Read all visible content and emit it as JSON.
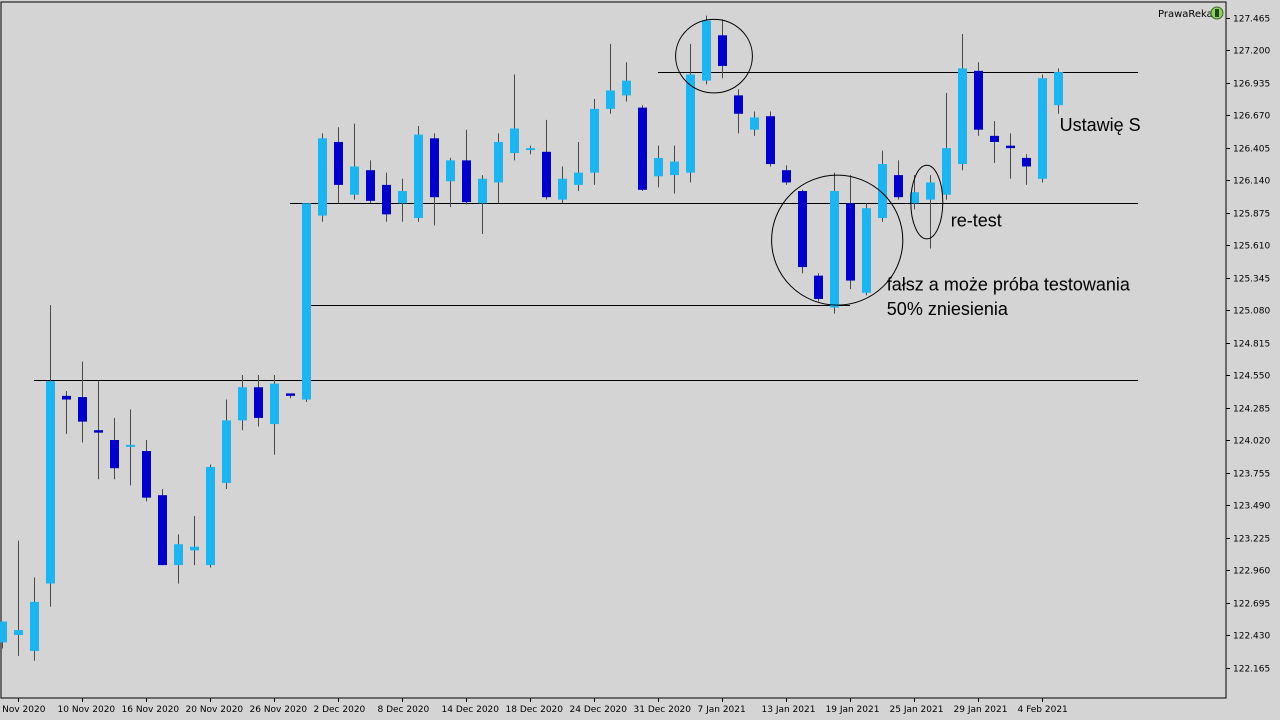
{
  "chart_data": {
    "type": "candlestick",
    "symbol_brand": "PrawaReka",
    "colors": {
      "background": "#d4d4d4",
      "bull": "#1eb4f0",
      "bear": "#0000c8",
      "wick": "#4a4a4a",
      "line": "#000000",
      "axis": "#000000"
    },
    "y_range": [
      122.0,
      127.5
    ],
    "y_ticks": [
      "127.465",
      "127.200",
      "126.935",
      "126.670",
      "126.405",
      "126.140",
      "125.875",
      "125.610",
      "125.345",
      "125.080",
      "124.815",
      "124.550",
      "124.285",
      "124.020",
      "123.755",
      "123.490",
      "123.225",
      "122.960",
      "122.695",
      "122.430",
      "122.165"
    ],
    "x_labels": [
      {
        "index": 1,
        "text": "4 Nov 2020"
      },
      {
        "index": 5,
        "text": "10 Nov 2020"
      },
      {
        "index": 9,
        "text": "16 Nov 2020"
      },
      {
        "index": 13,
        "text": "20 Nov 2020"
      },
      {
        "index": 17,
        "text": "26 Nov 2020"
      },
      {
        "index": 21,
        "text": "2 Dec 2020"
      },
      {
        "index": 25,
        "text": "8 Dec 2020"
      },
      {
        "index": 29,
        "text": "14 Dec 2020"
      },
      {
        "index": 33,
        "text": "18 Dec 2020"
      },
      {
        "index": 37,
        "text": "24 Dec 2020"
      },
      {
        "index": 41,
        "text": "31 Dec 2020"
      },
      {
        "index": 45,
        "text": "7 Jan 2021"
      },
      {
        "index": 49,
        "text": "13 Jan 2021"
      },
      {
        "index": 53,
        "text": "19 Jan 2021"
      },
      {
        "index": 57,
        "text": "25 Jan 2021"
      },
      {
        "index": 61,
        "text": "29 Jan 2021"
      },
      {
        "index": 65,
        "text": "4 Feb 2021"
      }
    ],
    "candles": [
      {
        "o": 122.37,
        "h": 122.5,
        "l": 122.32,
        "c": 122.54
      },
      {
        "o": 122.43,
        "h": 123.2,
        "l": 122.26,
        "c": 122.47
      },
      {
        "o": 122.3,
        "h": 122.9,
        "l": 122.22,
        "c": 122.7
      },
      {
        "o": 122.85,
        "h": 125.12,
        "l": 122.66,
        "c": 124.5
      },
      {
        "o": 124.38,
        "h": 124.42,
        "l": 124.07,
        "c": 124.35
      },
      {
        "o": 124.37,
        "h": 124.66,
        "l": 124.0,
        "c": 124.17
      },
      {
        "o": 124.1,
        "h": 124.5,
        "l": 123.7,
        "c": 124.08
      },
      {
        "o": 124.02,
        "h": 124.2,
        "l": 123.7,
        "c": 123.79
      },
      {
        "o": 123.98,
        "h": 124.27,
        "l": 123.65,
        "c": 123.98
      },
      {
        "o": 123.93,
        "h": 124.02,
        "l": 123.52,
        "c": 123.55
      },
      {
        "o": 123.57,
        "h": 123.62,
        "l": 123.02,
        "c": 123.0
      },
      {
        "o": 123.0,
        "h": 123.25,
        "l": 122.85,
        "c": 123.17
      },
      {
        "o": 123.12,
        "h": 123.4,
        "l": 123.0,
        "c": 123.15
      },
      {
        "o": 123.0,
        "h": 123.82,
        "l": 122.98,
        "c": 123.8
      },
      {
        "o": 123.67,
        "h": 124.35,
        "l": 123.62,
        "c": 124.18
      },
      {
        "o": 124.18,
        "h": 124.55,
        "l": 124.1,
        "c": 124.45
      },
      {
        "o": 124.45,
        "h": 124.55,
        "l": 124.13,
        "c": 124.2
      },
      {
        "o": 124.15,
        "h": 124.55,
        "l": 123.9,
        "c": 124.48
      },
      {
        "o": 124.4,
        "h": 124.4,
        "l": 124.36,
        "c": 124.38
      },
      {
        "o": 124.35,
        "h": 125.1,
        "l": 124.33,
        "c": 125.95
      },
      {
        "o": 125.85,
        "h": 126.52,
        "l": 125.8,
        "c": 126.48
      },
      {
        "o": 126.45,
        "h": 126.57,
        "l": 125.95,
        "c": 126.1
      },
      {
        "o": 126.02,
        "h": 126.6,
        "l": 125.98,
        "c": 126.25
      },
      {
        "o": 126.22,
        "h": 126.3,
        "l": 125.95,
        "c": 125.97
      },
      {
        "o": 126.1,
        "h": 126.2,
        "l": 125.8,
        "c": 125.86
      },
      {
        "o": 125.95,
        "h": 126.15,
        "l": 125.8,
        "c": 126.05
      },
      {
        "o": 125.83,
        "h": 126.58,
        "l": 125.8,
        "c": 126.51
      },
      {
        "o": 126.48,
        "h": 126.52,
        "l": 125.77,
        "c": 126.0
      },
      {
        "o": 126.13,
        "h": 126.32,
        "l": 125.92,
        "c": 126.3
      },
      {
        "o": 126.3,
        "h": 126.55,
        "l": 125.94,
        "c": 125.96
      },
      {
        "o": 125.95,
        "h": 126.18,
        "l": 125.7,
        "c": 126.15
      },
      {
        "o": 126.12,
        "h": 126.52,
        "l": 125.95,
        "c": 126.45
      },
      {
        "o": 126.36,
        "h": 127.0,
        "l": 126.3,
        "c": 126.56
      },
      {
        "o": 126.4,
        "h": 126.42,
        "l": 126.35,
        "c": 126.4
      },
      {
        "o": 126.37,
        "h": 126.63,
        "l": 125.98,
        "c": 126.0
      },
      {
        "o": 125.98,
        "h": 126.25,
        "l": 125.95,
        "c": 126.15
      },
      {
        "o": 126.1,
        "h": 126.45,
        "l": 126.05,
        "c": 126.2
      },
      {
        "o": 126.2,
        "h": 126.8,
        "l": 126.1,
        "c": 126.72
      },
      {
        "o": 126.72,
        "h": 127.25,
        "l": 126.68,
        "c": 126.87
      },
      {
        "o": 126.83,
        "h": 127.1,
        "l": 126.78,
        "c": 126.95
      },
      {
        "o": 126.73,
        "h": 126.75,
        "l": 126.05,
        "c": 126.06
      },
      {
        "o": 126.17,
        "h": 126.42,
        "l": 126.08,
        "c": 126.32
      },
      {
        "o": 126.18,
        "h": 126.42,
        "l": 126.03,
        "c": 126.29
      },
      {
        "o": 126.2,
        "h": 127.25,
        "l": 126.12,
        "c": 127.0
      },
      {
        "o": 126.95,
        "h": 127.48,
        "l": 126.92,
        "c": 127.44
      },
      {
        "o": 127.32,
        "h": 127.45,
        "l": 126.97,
        "c": 127.07
      },
      {
        "o": 126.83,
        "h": 126.88,
        "l": 126.52,
        "c": 126.68
      },
      {
        "o": 126.55,
        "h": 126.7,
        "l": 126.5,
        "c": 126.65
      },
      {
        "o": 126.66,
        "h": 126.7,
        "l": 126.25,
        "c": 126.27
      },
      {
        "o": 126.22,
        "h": 126.26,
        "l": 126.1,
        "c": 126.12
      },
      {
        "o": 126.05,
        "h": 126.06,
        "l": 125.38,
        "c": 125.43
      },
      {
        "o": 125.36,
        "h": 125.38,
        "l": 125.15,
        "c": 125.17
      },
      {
        "o": 125.1,
        "h": 126.2,
        "l": 125.05,
        "c": 126.05
      },
      {
        "o": 125.95,
        "h": 126.18,
        "l": 125.25,
        "c": 125.32
      },
      {
        "o": 125.22,
        "h": 125.95,
        "l": 125.2,
        "c": 125.91
      },
      {
        "o": 125.83,
        "h": 126.38,
        "l": 125.8,
        "c": 126.27
      },
      {
        "o": 126.18,
        "h": 126.3,
        "l": 125.98,
        "c": 126.0
      },
      {
        "o": 125.95,
        "h": 126.18,
        "l": 125.9,
        "c": 126.04
      },
      {
        "o": 125.98,
        "h": 126.18,
        "l": 125.58,
        "c": 126.12
      },
      {
        "o": 126.02,
        "h": 126.85,
        "l": 125.98,
        "c": 126.4
      },
      {
        "o": 126.27,
        "h": 127.33,
        "l": 126.22,
        "c": 127.05
      },
      {
        "o": 127.03,
        "h": 127.1,
        "l": 126.5,
        "c": 126.55
      },
      {
        "o": 126.5,
        "h": 126.62,
        "l": 126.28,
        "c": 126.45
      },
      {
        "o": 126.42,
        "h": 126.52,
        "l": 126.15,
        "c": 126.4
      },
      {
        "o": 126.32,
        "h": 126.35,
        "l": 126.1,
        "c": 126.25
      },
      {
        "o": 126.15,
        "h": 127.0,
        "l": 126.12,
        "c": 126.97
      },
      {
        "o": 126.75,
        "h": 127.05,
        "l": 126.68,
        "c": 127.02
      }
    ],
    "hlines": [
      {
        "price": 127.02,
        "from": 41,
        "to": 71
      },
      {
        "price": 125.95,
        "from": 18,
        "to": 71
      },
      {
        "price": 125.12,
        "from": 19,
        "to": 53
      },
      {
        "price": 124.51,
        "from": 2,
        "to": 71
      }
    ],
    "circles": [
      {
        "center_index": 44.5,
        "center_price": 127.15,
        "rx_bars": 2.4,
        "ry_price": 0.3
      },
      {
        "center_index": 52.2,
        "center_price": 125.65,
        "rx_bars": 4.1,
        "ry_price": 0.53
      },
      {
        "center_index": 57.8,
        "center_price": 125.96,
        "rx_bars": 1.0,
        "ry_price": 0.3
      }
    ],
    "annotations": [
      {
        "text": "Ustawię S",
        "index": 66.1,
        "price": 126.54
      },
      {
        "text": "re-test",
        "index": 59.3,
        "price": 125.76
      },
      {
        "text": "fałsz a może próba testowania",
        "index": 55.3,
        "price": 125.24
      },
      {
        "text": "50% zniesienia",
        "index": 55.3,
        "price": 125.04
      }
    ]
  }
}
